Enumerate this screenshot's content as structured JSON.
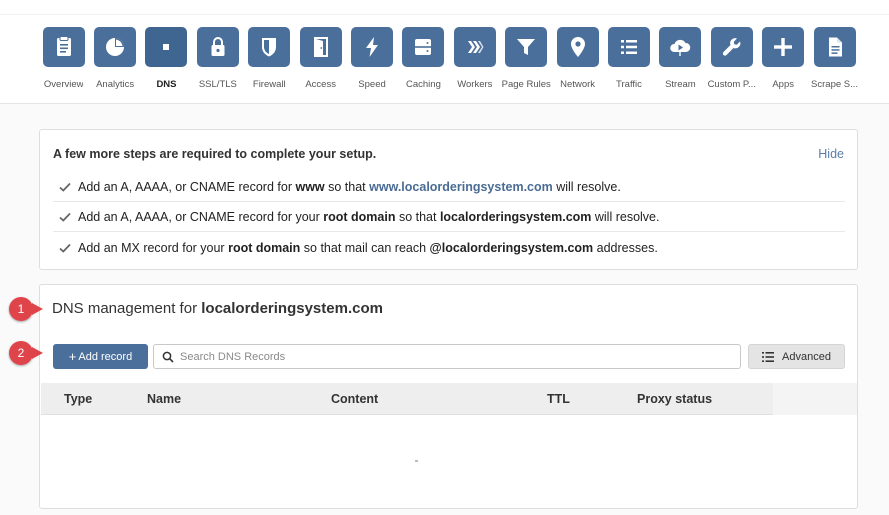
{
  "nav": {
    "items": [
      {
        "label": "Overview",
        "icon": "clipboard-icon",
        "active": false
      },
      {
        "label": "Analytics",
        "icon": "pie-chart-icon",
        "active": false
      },
      {
        "label": "DNS",
        "icon": "dns-icon",
        "active": true
      },
      {
        "label": "SSL/TLS",
        "icon": "lock-icon",
        "active": false
      },
      {
        "label": "Firewall",
        "icon": "shield-icon",
        "active": false
      },
      {
        "label": "Access",
        "icon": "door-icon",
        "active": false
      },
      {
        "label": "Speed",
        "icon": "lightning-icon",
        "active": false
      },
      {
        "label": "Caching",
        "icon": "server-icon",
        "active": false
      },
      {
        "label": "Workers",
        "icon": "workers-icon",
        "active": false
      },
      {
        "label": "Page Rules",
        "icon": "filter-icon",
        "active": false
      },
      {
        "label": "Network",
        "icon": "location-pin-icon",
        "active": false
      },
      {
        "label": "Traffic",
        "icon": "list-icon",
        "active": false
      },
      {
        "label": "Stream",
        "icon": "cloud-play-icon",
        "active": false
      },
      {
        "label": "Custom P...",
        "icon": "wrench-icon",
        "active": false
      },
      {
        "label": "Apps",
        "icon": "plus-icon",
        "active": false
      },
      {
        "label": "Scrape S...",
        "icon": "document-icon",
        "active": false
      }
    ]
  },
  "setup": {
    "title": "A few more steps are required to complete your setup.",
    "hide_label": "Hide",
    "steps": [
      {
        "a": "Add an A, AAAA, or CNAME record for ",
        "b": "www",
        "c": " so that ",
        "d": "www.localorderingsystem.com",
        "e": " will resolve."
      },
      {
        "a": "Add an A, AAAA, or CNAME record for your ",
        "b": "root domain",
        "c": " so that ",
        "d": "localorderingsystem.com",
        "e": " will resolve."
      },
      {
        "a": "Add an MX record for your ",
        "b": "root domain",
        "c": " so that mail can reach ",
        "d": "@localorderingsystem.com",
        "e": " addresses."
      }
    ]
  },
  "dns": {
    "title_prefix": "DNS management for ",
    "domain": "localorderingsystem.com",
    "add_label": "Add record",
    "add_plus": "+",
    "search_placeholder": "Search DNS Records",
    "advanced_label": "Advanced",
    "columns": [
      "Type",
      "Name",
      "Content",
      "TTL",
      "Proxy status"
    ]
  },
  "callouts": [
    "1",
    "2"
  ],
  "colors": {
    "accent": "#4b6f9b",
    "link": "#5a7ea8",
    "callout": "#e0444b"
  }
}
